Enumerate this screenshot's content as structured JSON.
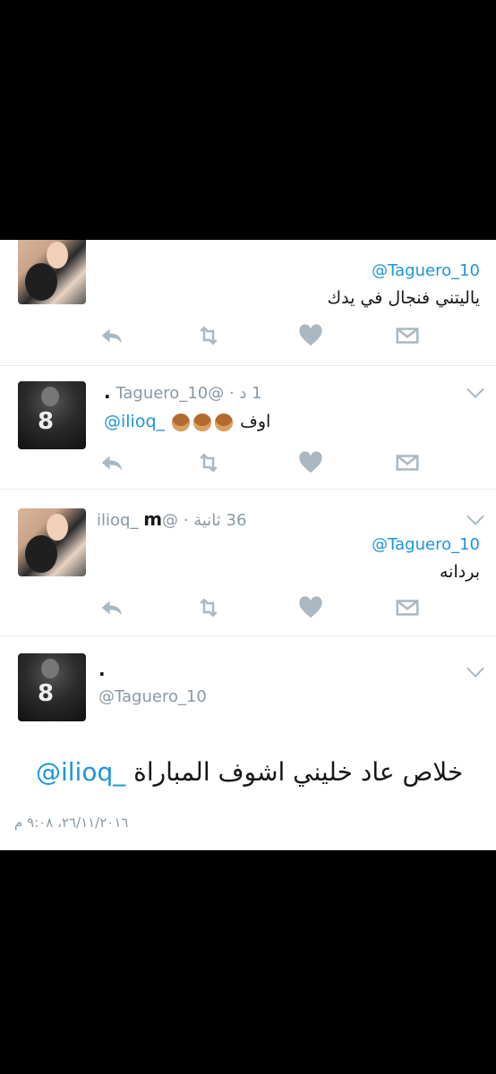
{
  "tweets": [
    {
      "mention": "@Taguero_10",
      "text": "ياليتني فنجال في يدك"
    },
    {
      "name": ".",
      "handle": "@Taguero_10",
      "time": "1 د",
      "mention": "@ilioq_",
      "text": "اوف"
    },
    {
      "name": "m",
      "handle": "@ilioq_",
      "time": "36 ثانية",
      "mention": "@Taguero_10",
      "text": "بردانه"
    }
  ],
  "main_tweet": {
    "name": ".",
    "handle": "@Taguero_10",
    "mention": "@ilioq_",
    "text": "خلاص عاد خليني اشوف المباراة",
    "timestamp": "٢٦/١١/٢٠١٦، ٩:٠٨ م"
  },
  "icons": {
    "reply": "reply-icon",
    "retweet": "retweet-icon",
    "like": "heart-icon",
    "dm": "direct-message-icon",
    "more": "chevron-down-icon"
  },
  "colors": {
    "mention": "#1b95e0",
    "meta": "#8899a6",
    "icon": "#aab8c2"
  }
}
